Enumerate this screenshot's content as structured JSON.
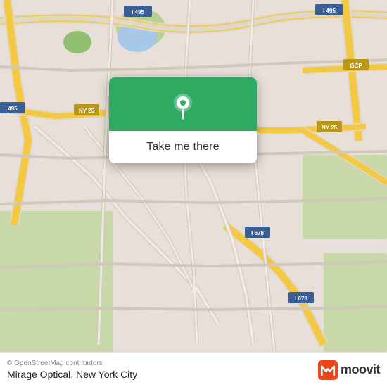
{
  "map": {
    "attribution": "© OpenStreetMap contributors",
    "bg_color": "#e8e0d8"
  },
  "card": {
    "button_label": "Take me there",
    "green_color": "#2eaa62"
  },
  "bottom_bar": {
    "location_name": "Mirage Optical, New York City",
    "attribution": "© OpenStreetMap contributors",
    "moovit_label": "moovit"
  },
  "roads": {
    "highway_color": "#f5c842",
    "highway_label_bg": "#b8971a",
    "road_color": "#ffffff",
    "minor_road": "#e8e0d8"
  }
}
